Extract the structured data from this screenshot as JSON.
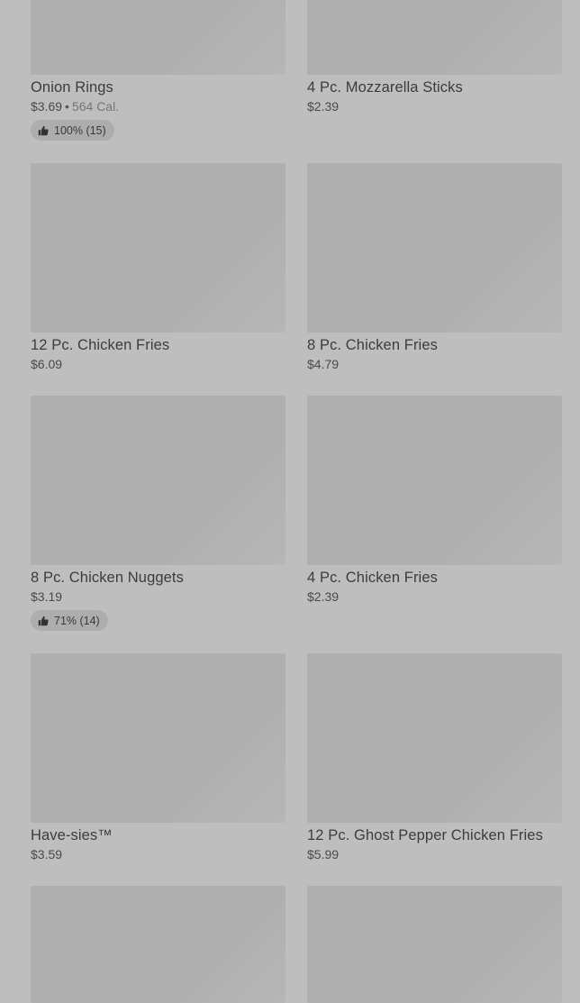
{
  "items": [
    {
      "name": "Onion Rings",
      "price": "$3.69",
      "calories": "564 Cal.",
      "rating": "100% (15)"
    },
    {
      "name": "4 Pc. Mozzarella Sticks",
      "price": "$2.39"
    },
    {
      "name": "12 Pc. Chicken Fries",
      "price": "$6.09"
    },
    {
      "name": "8 Pc. Chicken Fries",
      "price": "$4.79"
    },
    {
      "name": "8 Pc. Chicken Nuggets",
      "price": "$3.19",
      "rating": "71% (14)"
    },
    {
      "name": "4 Pc. Chicken Fries",
      "price": "$2.39"
    },
    {
      "name": "Have-sies™",
      "price": "$3.59"
    },
    {
      "name": "12 Pc. Ghost Pepper Chicken Fries",
      "price": "$5.99"
    }
  ],
  "separator": "•",
  "icons": {
    "rating": "thumbs-up-icon"
  }
}
